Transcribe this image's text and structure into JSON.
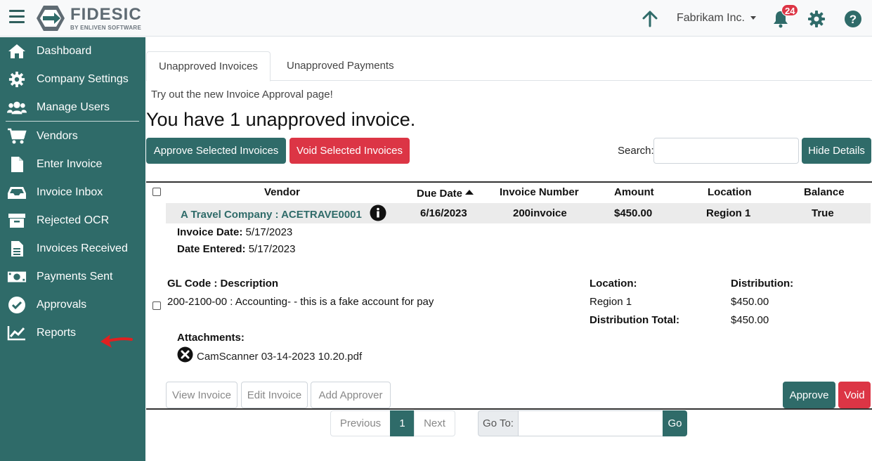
{
  "header": {
    "logo_text": "FIDESIC",
    "logo_sub": "BY ENLIVEN SOFTWARE",
    "company": "Fabrikam Inc.",
    "notification_count": "24"
  },
  "sidebar": {
    "items": [
      {
        "label": "Dashboard",
        "icon": "home-icon"
      },
      {
        "label": "Company Settings",
        "icon": "gear-icon"
      },
      {
        "label": "Manage Users",
        "icon": "users-icon"
      },
      {
        "label": "Vendors",
        "icon": "cart-icon"
      },
      {
        "label": "Enter Invoice",
        "icon": "file-icon"
      },
      {
        "label": "Invoice Inbox",
        "icon": "inbox-icon"
      },
      {
        "label": "Rejected OCR",
        "icon": "archive-icon"
      },
      {
        "label": "Invoices Received",
        "icon": "file-text-icon"
      },
      {
        "label": "Payments Sent",
        "icon": "money-icon"
      },
      {
        "label": "Approvals",
        "icon": "check-circle-icon"
      },
      {
        "label": "Reports",
        "icon": "chart-icon"
      }
    ]
  },
  "tabs": [
    "Unapproved Invoices",
    "Unapproved Payments"
  ],
  "main": {
    "tryout": "Try out the new Invoice Approval page!",
    "headline": "You have 1 unapproved invoice.",
    "approve_selected": "Approve Selected Invoices",
    "void_selected": "Void Selected Invoices",
    "search_label": "Search:",
    "search_value": "",
    "hide_details": "Hide Details"
  },
  "table": {
    "columns": [
      "Vendor",
      "Due Date",
      "Invoice Number",
      "Amount",
      "Location",
      "Balance"
    ],
    "row": {
      "vendor": "A Travel Company : ACETRAVE0001",
      "due_date": "6/16/2023",
      "invoice_number": "200invoice",
      "amount": "$450.00",
      "location": "Region 1",
      "balance": "True"
    }
  },
  "details": {
    "invoice_date_label": "Invoice Date:",
    "invoice_date": "5/17/2023",
    "date_entered_label": "Date Entered:",
    "date_entered": "5/17/2023",
    "gl_header": "GL Code : Description",
    "location_header": "Location:",
    "distribution_header": "Distribution:",
    "gl_line": "200-2100-00 : Accounting- - this is a fake account for pay",
    "gl_location": "Region 1",
    "gl_amount": "$450.00",
    "distribution_total_label": "Distribution Total:",
    "distribution_total": "$450.00",
    "attachments_label": "Attachments:",
    "attachment_name": "CamScanner 03-14-2023 10.20.pdf",
    "view_invoice": "View Invoice",
    "edit_invoice": "Edit Invoice",
    "add_approver": "Add Approver",
    "approve": "Approve",
    "void": "Void"
  },
  "pagination": {
    "previous": "Previous",
    "current": "1",
    "next": "Next",
    "goto_label": "Go To:",
    "go": "Go"
  },
  "colors": {
    "brand": "#2f6b69",
    "danger": "#dc3545"
  }
}
